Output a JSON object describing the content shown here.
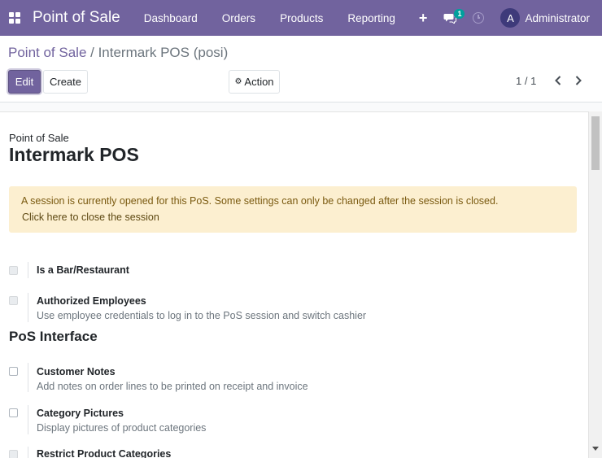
{
  "navbar": {
    "app_name": "Point of Sale",
    "menu": [
      "Dashboard",
      "Orders",
      "Products",
      "Reporting"
    ],
    "plus_label": "+",
    "message_count": "1",
    "avatar_letter": "A",
    "user_name": "Administrator"
  },
  "breadcrumb": {
    "parent": "Point of Sale",
    "separator": " / ",
    "current": "Intermark POS (posi)"
  },
  "buttons": {
    "edit": "Edit",
    "create": "Create",
    "action": "Action"
  },
  "pager": {
    "text": "1 / 1"
  },
  "form": {
    "label": "Point of Sale",
    "title": "Intermark POS",
    "alert_message": "A session is currently opened for this PoS. Some settings can only be changed after the session is closed.",
    "alert_link": "Click here to close the session",
    "section_title": "PoS Interface",
    "settings": [
      {
        "title": "Is a Bar/Restaurant",
        "description": "",
        "disabled": true
      },
      {
        "title": "Authorized Employees",
        "description": "Use employee credentials to log in to the PoS session and switch cashier",
        "disabled": true
      },
      {
        "title": "Customer Notes",
        "description": "Add notes on order lines to be printed on receipt and invoice",
        "disabled": false
      },
      {
        "title": "Category Pictures",
        "description": "Display pictures of product categories",
        "disabled": false
      },
      {
        "title": "Restrict Product Categories",
        "description": "",
        "disabled": true
      }
    ]
  },
  "colors": {
    "brand": "#71639e",
    "alert_bg": "#fcefd0",
    "badge": "#00a09d"
  }
}
